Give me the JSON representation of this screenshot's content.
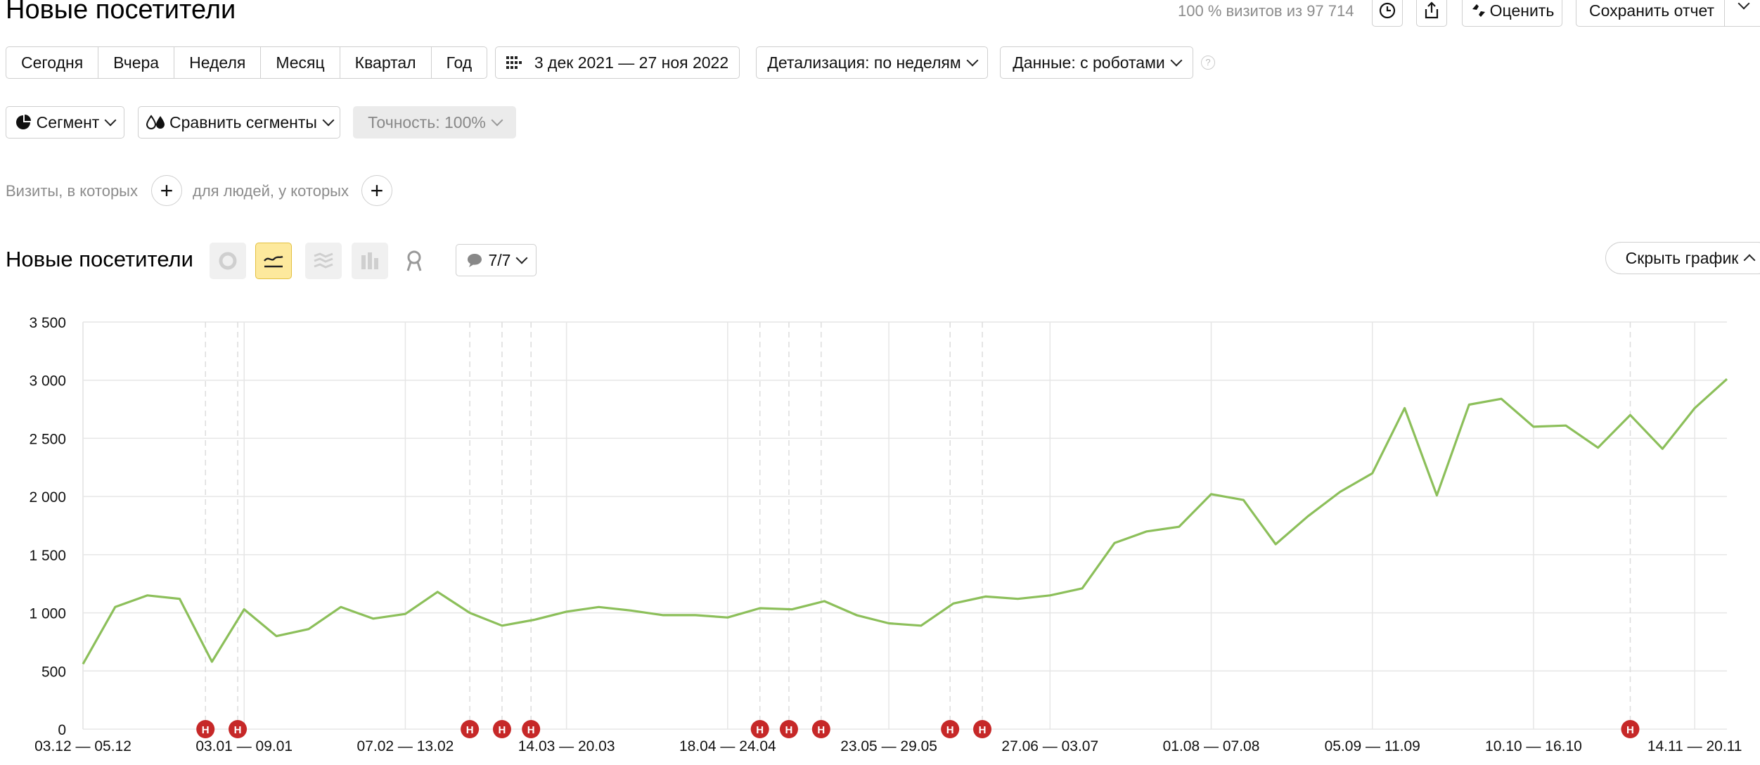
{
  "header": {
    "title": "Новые посетители",
    "visits_info": "100 % визитов из 97 714",
    "rate_label": "Оценить",
    "save_label": "Сохранить отчет"
  },
  "periods": [
    "Сегодня",
    "Вчера",
    "Неделя",
    "Месяц",
    "Квартал",
    "Год"
  ],
  "filters": {
    "date_range": "3 дек 2021 — 27 ноя 2022",
    "detail": "Детализация: по неделям",
    "data": "Данные: с роботами",
    "segment": "Сегмент",
    "compare": "Сравнить сегменты",
    "accuracy": "Точность: 100%",
    "visits_cond": "Визиты, в которых",
    "people_cond": "для людей, у которых"
  },
  "chart_header": {
    "title": "Новые посетители",
    "notes_count": "7/7",
    "hide_label": "Скрыть график"
  },
  "colors": {
    "line": "#8cbf5a",
    "marker": "#c62828",
    "active_tab": "#fde99d"
  },
  "chart_data": {
    "type": "line",
    "ylim": [
      0,
      3500
    ],
    "yticks": [
      "0",
      "500",
      "1 000",
      "1 500",
      "2 000",
      "2 500",
      "3 000",
      "3 500"
    ],
    "x_tick_labels": [
      "03.12 — 05.12",
      "03.01 — 09.01",
      "07.02 — 13.02",
      "14.03 — 20.03",
      "18.04 — 24.04",
      "23.05 — 29.05",
      "27.06 — 03.07",
      "01.08 — 07.08",
      "05.09 — 11.09",
      "10.10 — 16.10",
      "14.11 — 20.11"
    ],
    "x_tick_index": [
      0,
      5,
      10,
      15,
      20,
      25,
      30,
      35,
      40,
      45,
      50
    ],
    "grid": true,
    "series": [
      {
        "values": [
          560,
          1050,
          1150,
          1120,
          580,
          1030,
          800,
          860,
          1050,
          950,
          990,
          1180,
          1000,
          890,
          940,
          1010,
          1050,
          1020,
          980,
          980,
          960,
          1040,
          1030,
          1100,
          980,
          910,
          890,
          1080,
          1140,
          1120,
          1150,
          1210,
          1600,
          1700,
          1740,
          2020,
          1970,
          1590,
          1830,
          2040,
          2200,
          2760,
          2010,
          2790,
          2840,
          2600,
          2610,
          2420,
          2700,
          2410,
          2760,
          3010
        ]
      }
    ],
    "annotations": {
      "marker_label": "Н",
      "week_index": [
        3.8,
        4.8,
        12.0,
        13.0,
        13.9,
        21.0,
        21.9,
        22.9,
        26.9,
        27.9,
        48.0
      ]
    }
  }
}
